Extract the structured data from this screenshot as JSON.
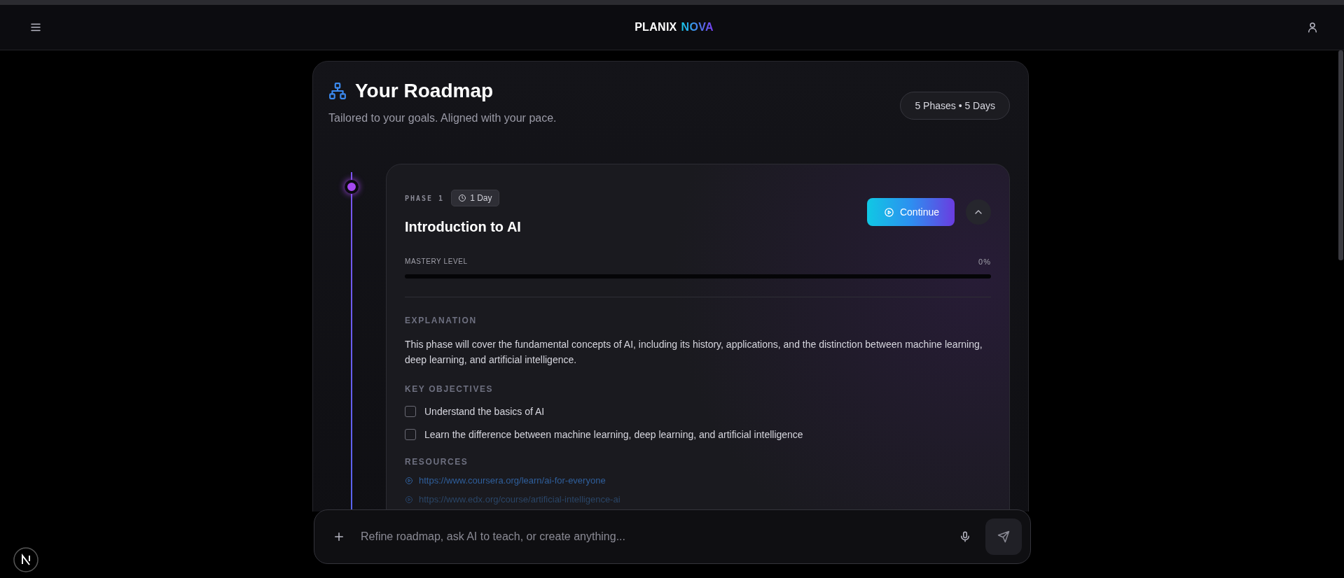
{
  "header": {
    "brand": [
      {
        "text": "PLANIX",
        "kind": "plain"
      },
      {
        "text": "NOVA",
        "kind": "gradient"
      }
    ]
  },
  "roadmap": {
    "title": "Your Roadmap",
    "subtitle": "Tailored to your goals. Aligned with your pace.",
    "summary": "5 Phases • 5 Days"
  },
  "phases": [
    {
      "phase_label": "PHASE 1",
      "duration": "1 Day",
      "title": "Introduction to AI",
      "action": "Continue",
      "active": true,
      "expanded": true,
      "mastery_label": "MASTERY LEVEL",
      "mastery_reading": "0%",
      "level": 0,
      "explanation_heading": "EXPLANATION",
      "explanation": "This phase will cover the fundamental concepts of AI, including its history, applications, and the distinction between machine learning, deep learning, and artificial intelligence.",
      "objectives_heading": "KEY OBJECTIVES",
      "objectives": [
        {
          "text": "Understand the basics of AI",
          "checked": false
        },
        {
          "text": "Learn the difference between machine learning, deep learning, and artificial intelligence",
          "checked": false
        }
      ],
      "resources_heading": "RESOURCES",
      "resources": [
        "https://www.coursera.org/learn/ai-for-everyone",
        "https://www.edx.org/course/artificial-intelligence-ai"
      ]
    }
  ],
  "chat": {
    "placeholder": "Refine roadmap, ask AI to teach, or create anything..."
  }
}
